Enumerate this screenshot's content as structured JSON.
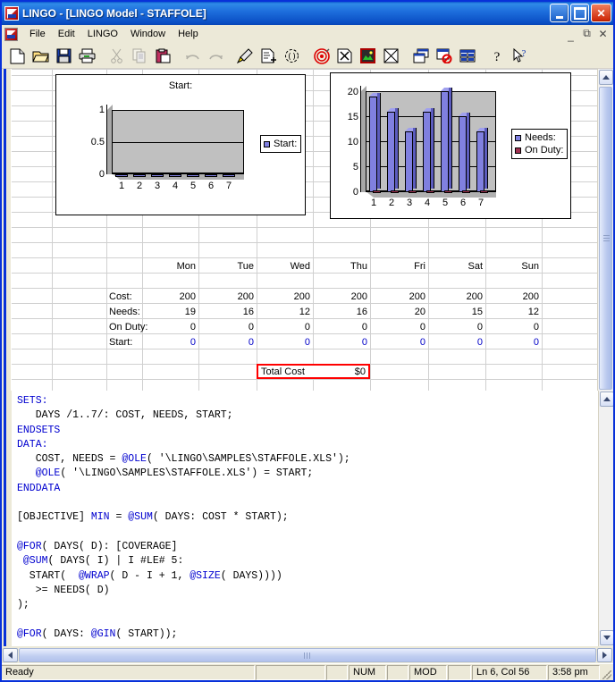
{
  "window": {
    "title": "LINGO - [LINGO Model - STAFFOLE]",
    "app_icon": "lingo-icon",
    "buttons": {
      "minimize": "minimize-button",
      "maximize": "maximize-button",
      "close": "close-button"
    }
  },
  "menu": {
    "items": [
      "File",
      "Edit",
      "LINGO",
      "Window",
      "Help"
    ],
    "mdi_buttons": [
      "_",
      "❐",
      "✕"
    ]
  },
  "toolbar": {
    "groups": [
      [
        {
          "name": "new-icon",
          "label": "New",
          "disabled": false
        },
        {
          "name": "open-icon",
          "label": "Open",
          "disabled": false
        },
        {
          "name": "save-icon",
          "label": "Save",
          "disabled": false
        },
        {
          "name": "print-icon",
          "label": "Print",
          "disabled": false
        }
      ],
      [
        {
          "name": "cut-icon",
          "label": "Cut",
          "disabled": true
        },
        {
          "name": "copy-icon",
          "label": "Copy",
          "disabled": true
        },
        {
          "name": "paste-icon",
          "label": "Paste",
          "disabled": false
        }
      ],
      [
        {
          "name": "undo-icon",
          "label": "Undo",
          "disabled": true
        },
        {
          "name": "redo-icon",
          "label": "Redo",
          "disabled": true
        }
      ],
      [
        {
          "name": "find-icon",
          "label": "Find",
          "disabled": false
        },
        {
          "name": "match-parenthesis-icon",
          "label": "Match Parenthesis",
          "disabled": false
        },
        {
          "name": "paren-match-icon",
          "label": "Paren Match",
          "disabled": false
        }
      ],
      [
        {
          "name": "solve-target-icon",
          "label": "Solve",
          "disabled": false
        },
        {
          "name": "solution-report-icon",
          "label": "Solution Report",
          "disabled": false
        },
        {
          "name": "picture-icon",
          "label": "Picture",
          "disabled": false
        },
        {
          "name": "close-all-icon",
          "label": "Close All",
          "disabled": false
        }
      ],
      [
        {
          "name": "tile-windows-icon",
          "label": "Tile Windows",
          "disabled": false
        },
        {
          "name": "clear-markers-icon",
          "label": "Clear Markers",
          "disabled": false
        },
        {
          "name": "split-window-icon",
          "label": "Split Window",
          "disabled": false
        }
      ],
      [
        {
          "name": "help-icon",
          "label": "Help",
          "disabled": false
        },
        {
          "name": "context-help-icon",
          "label": "Context Help",
          "disabled": false
        }
      ]
    ]
  },
  "spreadsheet": {
    "day_headers": [
      "Mon",
      "Tue",
      "Wed",
      "Thu",
      "Fri",
      "Sat",
      "Sun"
    ],
    "rows": [
      {
        "label": "Cost:",
        "values": [
          "200",
          "200",
          "200",
          "200",
          "200",
          "200",
          "200"
        ],
        "color": "#000000"
      },
      {
        "label": "Needs:",
        "values": [
          "19",
          "16",
          "12",
          "16",
          "20",
          "15",
          "12"
        ],
        "color": "#000000"
      },
      {
        "label": "On Duty:",
        "values": [
          "0",
          "0",
          "0",
          "0",
          "0",
          "0",
          "0"
        ],
        "color": "#000000"
      },
      {
        "label": "Start:",
        "values": [
          "0",
          "0",
          "0",
          "0",
          "0",
          "0",
          "0"
        ],
        "color": "#0000c8"
      }
    ],
    "total": {
      "label": "Total Cost",
      "value": "$0",
      "border_color": "#ff0000"
    }
  },
  "chart_data": [
    {
      "type": "bar",
      "title": "Start:",
      "categories": [
        "1",
        "2",
        "3",
        "4",
        "5",
        "6",
        "7"
      ],
      "series": [
        {
          "name": "Start:",
          "values": [
            0,
            0,
            0,
            0,
            0,
            0,
            0
          ],
          "color": "#8080e0"
        }
      ],
      "ylim": [
        0,
        1
      ],
      "yticks": [
        "0",
        "0.5",
        "1"
      ],
      "xlabel": "",
      "ylabel": "",
      "grid": true,
      "legend_position": "right",
      "legend": [
        "Start:"
      ]
    },
    {
      "type": "bar",
      "title": "",
      "categories": [
        "1",
        "2",
        "3",
        "4",
        "5",
        "6",
        "7"
      ],
      "series": [
        {
          "name": "Needs:",
          "values": [
            19,
            16,
            12,
            16,
            20,
            15,
            12
          ],
          "color": "#8080e0"
        },
        {
          "name": "On Duty:",
          "values": [
            0,
            0,
            0,
            0,
            0,
            0,
            0
          ],
          "color": "#a03050"
        }
      ],
      "ylim": [
        0,
        20
      ],
      "yticks": [
        "0",
        "5",
        "10",
        "15",
        "20"
      ],
      "xlabel": "",
      "ylabel": "",
      "grid": true,
      "legend_position": "right",
      "legend": [
        "Needs:",
        "On Duty:"
      ]
    }
  ],
  "code": {
    "lines": [
      [
        {
          "t": "SETS:",
          "k": true
        }
      ],
      [
        {
          "t": "   DAYS /1..7/: COST, NEEDS, START;",
          "k": false
        }
      ],
      [
        {
          "t": "ENDSETS",
          "k": true
        }
      ],
      [
        {
          "t": "DATA:",
          "k": true
        }
      ],
      [
        {
          "t": "   COST, NEEDS = ",
          "k": false
        },
        {
          "t": "@OLE",
          "k": true
        },
        {
          "t": "( '\\LINGO\\SAMPLES\\STAFFOLE.XLS');",
          "k": false
        }
      ],
      [
        {
          "t": "   ",
          "k": false
        },
        {
          "t": "@OLE",
          "k": true
        },
        {
          "t": "( '\\LINGO\\SAMPLES\\STAFFOLE.XLS') = START;",
          "k": false
        }
      ],
      [
        {
          "t": "ENDDATA",
          "k": true
        }
      ],
      [
        {
          "t": "",
          "k": false
        }
      ],
      [
        {
          "t": "[OBJECTIVE] ",
          "k": false
        },
        {
          "t": "MIN",
          "k": true
        },
        {
          "t": " = ",
          "k": false
        },
        {
          "t": "@SUM",
          "k": true
        },
        {
          "t": "( DAYS: COST * START);",
          "k": false
        }
      ],
      [
        {
          "t": "",
          "k": false
        }
      ],
      [
        {
          "t": "@FOR",
          "k": true
        },
        {
          "t": "( DAYS( D): [COVERAGE]",
          "k": false
        }
      ],
      [
        {
          "t": " ",
          "k": false
        },
        {
          "t": "@SUM",
          "k": true
        },
        {
          "t": "( DAYS( I) | I #LE# 5:",
          "k": false
        }
      ],
      [
        {
          "t": "  START(  ",
          "k": false
        },
        {
          "t": "@WRAP",
          "k": true
        },
        {
          "t": "( D - I + 1, ",
          "k": false
        },
        {
          "t": "@SIZE",
          "k": true
        },
        {
          "t": "( DAYS))))",
          "k": false
        }
      ],
      [
        {
          "t": "   >= NEEDS( D)",
          "k": false
        }
      ],
      [
        {
          "t": ");",
          "k": false
        }
      ],
      [
        {
          "t": "",
          "k": false
        }
      ],
      [
        {
          "t": "@FOR",
          "k": true
        },
        {
          "t": "( DAYS: ",
          "k": false
        },
        {
          "t": "@GIN",
          "k": true
        },
        {
          "t": "( START));",
          "k": false
        }
      ]
    ]
  },
  "statusbar": {
    "ready": "Ready",
    "pane2": "",
    "pane3": "",
    "num": "NUM",
    "pane5": "",
    "mod": "MOD",
    "pane7": "",
    "position": "Ln 6, Col 56",
    "time": "3:58 pm"
  }
}
